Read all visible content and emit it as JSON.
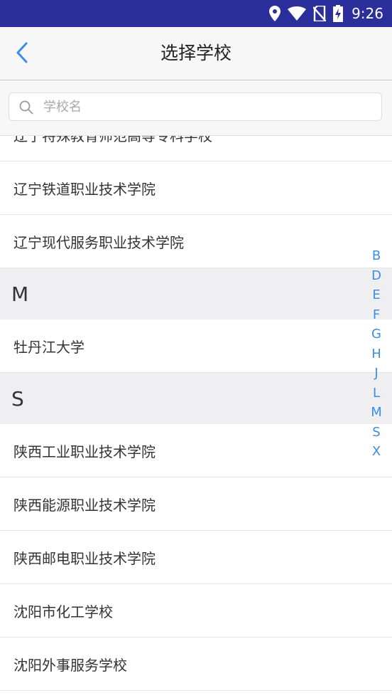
{
  "status_bar": {
    "time": "9:26"
  },
  "header": {
    "title": "选择学校"
  },
  "search": {
    "placeholder": "学校名"
  },
  "list": {
    "top_partial_item": "辽宁特殊教育师范高等专科学校",
    "items_l": [
      "辽宁铁道职业技术学院",
      "辽宁现代服务职业技术学院"
    ],
    "section_m": "M",
    "items_m": [
      "牡丹江大学"
    ],
    "section_s": "S",
    "items_s": [
      "陕西工业职业技术学院",
      "陕西能源职业技术学院",
      "陕西邮电职业技术学院",
      "沈阳市化工学校",
      "沈阳外事服务学校"
    ]
  },
  "index_bar": [
    "B",
    "D",
    "E",
    "F",
    "G",
    "H",
    "J",
    "L",
    "M",
    "S",
    "X"
  ],
  "colors": {
    "status_bar": "#2b2f9c",
    "accent": "#3b8ee6",
    "section_bg": "#efeff2"
  }
}
